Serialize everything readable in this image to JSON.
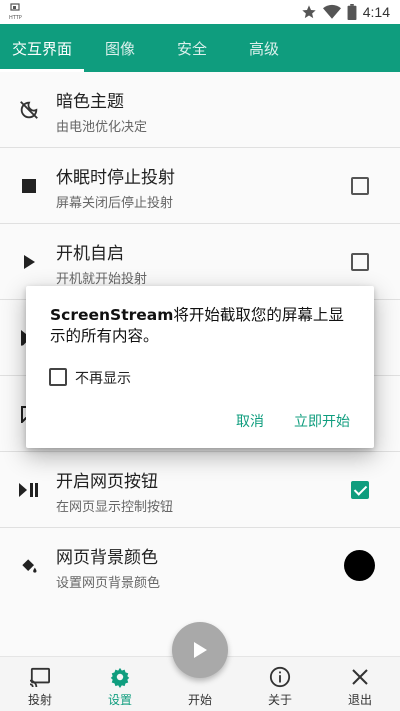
{
  "status_bar": {
    "time": "4:14",
    "left_icon": "cast-http-icon",
    "icons": [
      "star-icon",
      "wifi-icon",
      "battery-icon"
    ]
  },
  "tabs": [
    {
      "label": "交互界面",
      "active": true
    },
    {
      "label": "图像",
      "active": false
    },
    {
      "label": "安全",
      "active": false
    },
    {
      "label": "高级",
      "active": false
    }
  ],
  "settings": [
    {
      "icon": "theme-auto-icon",
      "title": "暗色主题",
      "subtitle": "由电池优化决定"
    },
    {
      "icon": "stop-icon",
      "title": "休眠时停止投射",
      "subtitle": "屏幕关闭后停止投射",
      "checked": false
    },
    {
      "icon": "play-icon",
      "title": "开机自启",
      "subtitle": "开机就开始投射",
      "checked": false
    },
    {
      "icon": "skip-icon",
      "title": "",
      "subtitle": ""
    },
    {
      "icon": "message-icon",
      "title": "",
      "subtitle": ""
    },
    {
      "icon": "play-pause-icon",
      "title": "开启网页按钮",
      "subtitle": "在网页显示控制按钮",
      "checked": true
    },
    {
      "icon": "paint-bucket-icon",
      "title": "网页背景颜色",
      "subtitle": "设置网页背景颜色",
      "color": "#000000"
    }
  ],
  "dialog": {
    "message_app": "ScreenStream",
    "message_rest": "将开始截取您的屏幕上显示的所有内容。",
    "checkbox_label": "不再显示",
    "checkbox_checked": false,
    "cancel_label": "取消",
    "start_label": "立即开始"
  },
  "bottom_nav": [
    {
      "label": "投射",
      "icon": "cast-icon",
      "active": false
    },
    {
      "label": "设置",
      "icon": "gear-icon",
      "active": true
    },
    {
      "label": "开始",
      "icon": "play-icon",
      "active": false
    },
    {
      "label": "关于",
      "icon": "info-icon",
      "active": false
    },
    {
      "label": "退出",
      "icon": "close-icon",
      "active": false
    }
  ],
  "colors": {
    "accent": "#0f9d7e",
    "fab": "#a9a9a9"
  }
}
